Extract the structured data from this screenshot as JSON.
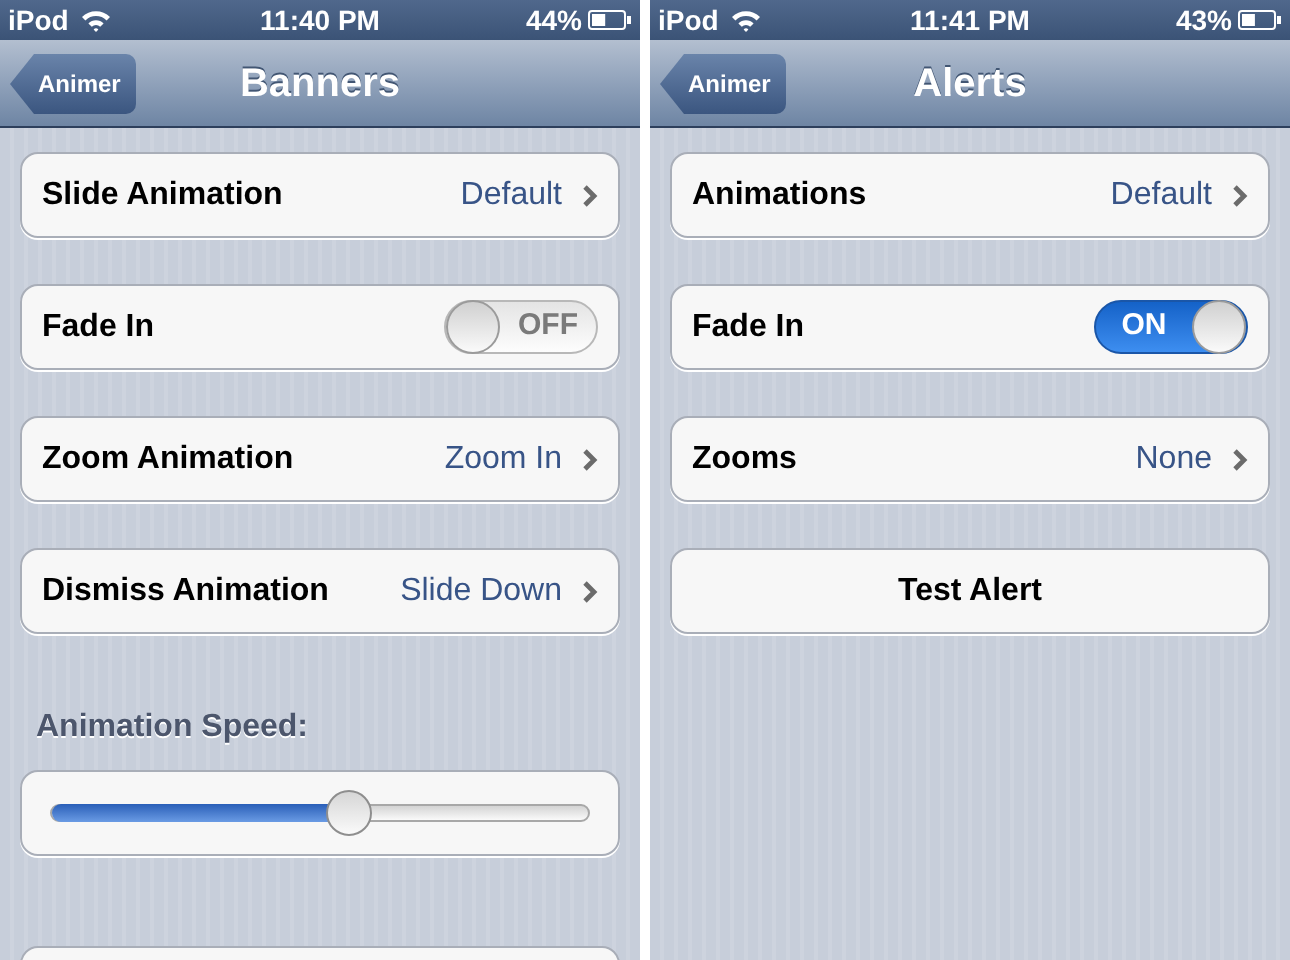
{
  "screens": [
    {
      "status_bar": {
        "carrier": "iPod",
        "time": "11:40 PM",
        "battery": "44%"
      },
      "nav_bar": {
        "back_button": "Animer",
        "title": "Banners"
      },
      "rows": [
        {
          "kind": "disclosure",
          "label": "Slide Animation",
          "value": "Default"
        },
        {
          "kind": "switch",
          "label": "Fade In",
          "switch_text": "OFF",
          "on": false
        },
        {
          "kind": "disclosure",
          "label": "Zoom Animation",
          "value": "Zoom In"
        },
        {
          "kind": "disclosure",
          "label": "Dismiss Animation",
          "value": "Slide Down"
        }
      ],
      "slider": {
        "label": "Animation Speed:",
        "level": 0.55
      },
      "more_below": true
    },
    {
      "status_bar": {
        "carrier": "iPod",
        "time": "11:41 PM",
        "battery": "43%"
      },
      "nav_bar": {
        "back_button": "Animer",
        "title": "Alerts"
      },
      "rows": [
        {
          "kind": "disclosure",
          "label": "Animations",
          "value": "Default"
        },
        {
          "kind": "switch",
          "label": "Fade In",
          "switch_text": "ON",
          "on": true
        },
        {
          "kind": "disclosure",
          "label": "Zooms",
          "value": "None"
        },
        {
          "kind": "button",
          "label": "Test Alert"
        }
      ]
    }
  ]
}
